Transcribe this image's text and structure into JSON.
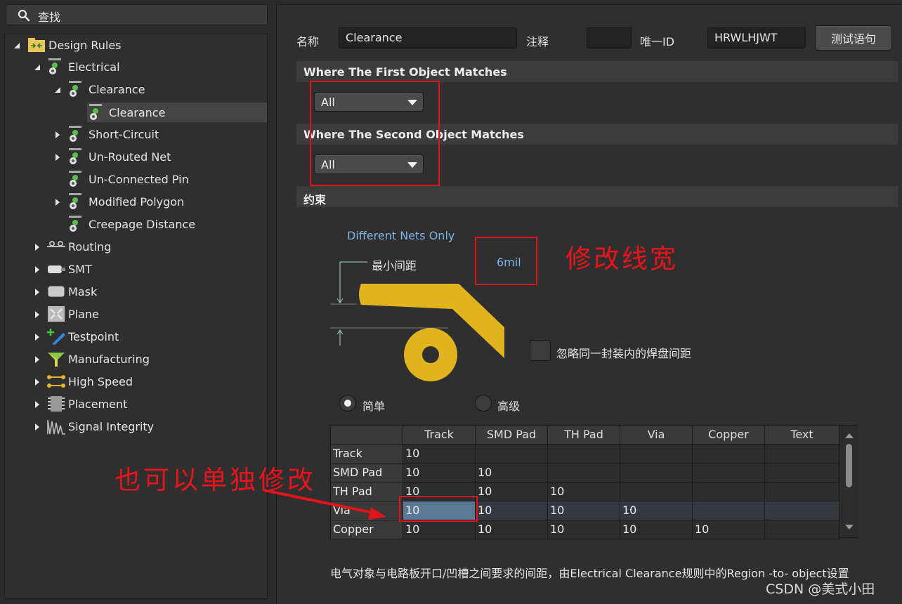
{
  "search": {
    "label": "查找"
  },
  "tree": {
    "items": [
      {
        "label": "Design Rules"
      },
      {
        "label": "Electrical"
      },
      {
        "label": "Clearance"
      },
      {
        "label": "Clearance"
      },
      {
        "label": "Short-Circuit"
      },
      {
        "label": "Un-Routed Net"
      },
      {
        "label": "Un-Connected Pin"
      },
      {
        "label": "Modified Polygon"
      },
      {
        "label": "Creepage Distance"
      },
      {
        "label": "Routing"
      },
      {
        "label": "SMT"
      },
      {
        "label": "Mask"
      },
      {
        "label": "Plane"
      },
      {
        "label": "Testpoint"
      },
      {
        "label": "Manufacturing"
      },
      {
        "label": "High Speed"
      },
      {
        "label": "Placement"
      },
      {
        "label": "Signal Integrity"
      }
    ]
  },
  "header": {
    "name_label": "名称",
    "name_value": "Clearance",
    "comment_label": "注释",
    "comment_value": "",
    "uid_label": "唯一ID",
    "uid_value": "HRWLHJWT",
    "test_button": "测试语句"
  },
  "first_match": {
    "title": "Where The First Object Matches",
    "value": "All"
  },
  "second_match": {
    "title": "Where The Second Object Matches",
    "value": "All"
  },
  "constraints": {
    "title": "约束",
    "nets_mode": "Different Nets Only",
    "min_clearance_label": "最小间距",
    "min_clearance_value": "6mil",
    "ignore_pad_label": "忽略同一封装内的焊盘间距",
    "radio_simple": "简单",
    "radio_advanced": "高级"
  },
  "matrix": {
    "columns": [
      "Track",
      "SMD Pad",
      "TH Pad",
      "Via",
      "Copper",
      "Text"
    ],
    "rows": [
      {
        "label": "Track",
        "values": [
          "10",
          "",
          "",
          "",
          "",
          ""
        ]
      },
      {
        "label": "SMD Pad",
        "values": [
          "10",
          "10",
          "",
          "",
          "",
          ""
        ]
      },
      {
        "label": "TH Pad",
        "values": [
          "10",
          "10",
          "10",
          "",
          "",
          ""
        ]
      },
      {
        "label": "Via",
        "values": [
          "10",
          "10",
          "10",
          "10",
          "",
          ""
        ]
      },
      {
        "label": "Copper",
        "values": [
          "10",
          "10",
          "10",
          "10",
          "10",
          ""
        ]
      }
    ]
  },
  "annotations": {
    "modify_width": "修改线宽",
    "modify_single": "也可以单独修改"
  },
  "footer": "电气对象与电路板开口/凹槽之间要求的间距，由Electrical Clearance规则中的Region -to- object设置",
  "watermark": "CSDN @美式小田",
  "colors": {
    "accent_red": "#e0151b",
    "copper_gold": "#e1b31e",
    "selected_cell": "#5b7895",
    "link_blue": "#7fb2e6"
  }
}
